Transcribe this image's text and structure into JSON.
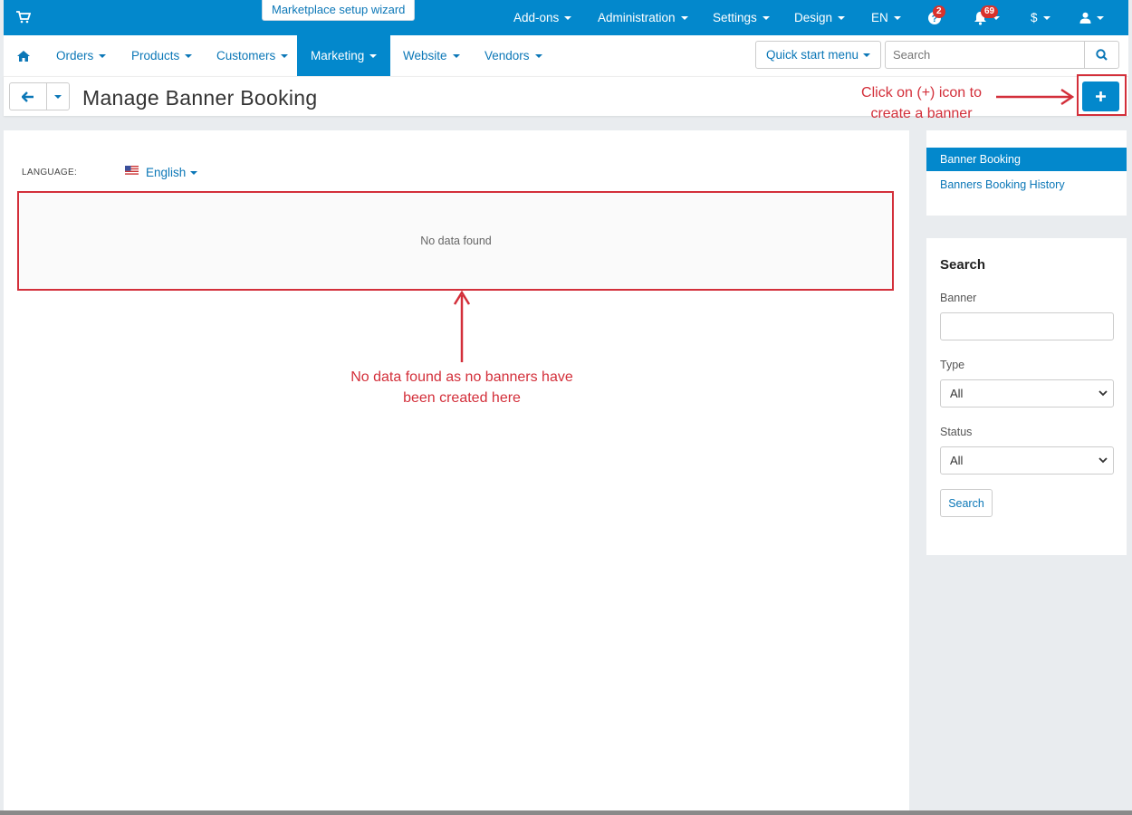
{
  "topbar": {
    "wizard_label": "Marketplace setup wizard",
    "menus": [
      "Add-ons",
      "Administration",
      "Settings",
      "Design",
      "EN"
    ],
    "help_badge": "2",
    "notifications_badge": "69",
    "currency": "$",
    "icons": [
      "cart-icon",
      "help-icon",
      "bell-icon",
      "user-icon"
    ]
  },
  "nav": {
    "items": [
      "Orders",
      "Products",
      "Customers",
      "Marketing",
      "Website",
      "Vendors"
    ],
    "active": "Marketing",
    "quick_start": "Quick start menu",
    "search_placeholder": "Search"
  },
  "page": {
    "title": "Manage Banner Booking"
  },
  "main": {
    "language_label": "LANGUAGE:",
    "language_value": "English",
    "empty_message": "No data found"
  },
  "sidebar": {
    "links": [
      "Banner Booking",
      "Banners Booking History"
    ],
    "active_link": "Banner Booking",
    "search": {
      "title": "Search",
      "banner_label": "Banner",
      "banner_value": "",
      "type_label": "Type",
      "type_value": "All",
      "status_label": "Status",
      "status_value": "All",
      "button_label": "Search"
    }
  },
  "annotations": {
    "add_hint_line1": "Click on (+) icon to",
    "add_hint_line2": "create a banner",
    "empty_hint_line1": "No data found as no banners have",
    "empty_hint_line2": "been created here"
  },
  "colors": {
    "primary": "#0388cc",
    "link": "#0b77b7",
    "badge": "#d9322c",
    "annotation": "#d32f3a"
  }
}
